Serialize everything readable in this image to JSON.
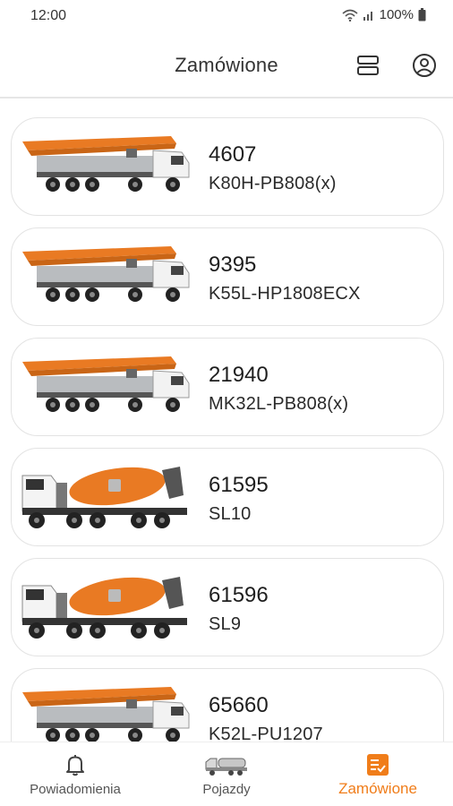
{
  "status_bar": {
    "time": "12:00",
    "battery": "100%"
  },
  "header": {
    "title": "Zamówione"
  },
  "orders": [
    {
      "number": "4607",
      "model": "K80H-PB808(x)",
      "vehicle_type": "pump"
    },
    {
      "number": "9395",
      "model": "K55L-HP1808ECX",
      "vehicle_type": "pump"
    },
    {
      "number": "21940",
      "model": "MK32L-PB808(x)",
      "vehicle_type": "pump"
    },
    {
      "number": "61595",
      "model": "SL10",
      "vehicle_type": "mixer"
    },
    {
      "number": "61596",
      "model": "SL9",
      "vehicle_type": "mixer"
    },
    {
      "number": "65660",
      "model": "K52L-PU1207",
      "vehicle_type": "pump"
    }
  ],
  "bottom_nav": {
    "items": [
      {
        "label": "Powiadomienia",
        "icon": "bell-icon"
      },
      {
        "label": "Pojazdy",
        "icon": "truck-icon"
      },
      {
        "label": "Zamówione",
        "icon": "clipboard-check-icon",
        "active": true
      }
    ]
  },
  "colors": {
    "accent": "#f07d1a",
    "truck_orange": "#e97a23",
    "truck_gray": "#b9bcbf"
  }
}
